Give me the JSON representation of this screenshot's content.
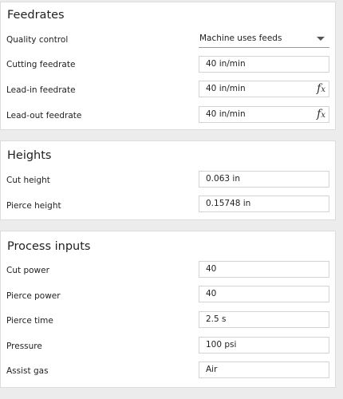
{
  "feedrates": {
    "title": "Feedrates",
    "quality_control": {
      "label": "Quality control",
      "value": "Machine uses feeds"
    },
    "cutting_feedrate": {
      "label": "Cutting feedrate",
      "value": "40 in/min"
    },
    "lead_in_feedrate": {
      "label": "Lead-in feedrate",
      "value": "40 in/min",
      "fx": "f",
      "fx_sub": "x"
    },
    "lead_out_feedrate": {
      "label": "Lead-out feedrate",
      "value": "40 in/min",
      "fx": "f",
      "fx_sub": "x"
    }
  },
  "heights": {
    "title": "Heights",
    "cut_height": {
      "label": "Cut height",
      "value": "0.063 in"
    },
    "pierce_height": {
      "label": "Pierce height",
      "value": "0.15748 in"
    }
  },
  "process_inputs": {
    "title": "Process inputs",
    "cut_power": {
      "label": "Cut power",
      "value": "40"
    },
    "pierce_power": {
      "label": "Pierce power",
      "value": "40"
    },
    "pierce_time": {
      "label": "Pierce time",
      "value": "2.5 s"
    },
    "pressure": {
      "label": "Pressure",
      "value": "100 psi"
    },
    "assist_gas": {
      "label": "Assist gas",
      "value": "Air"
    }
  }
}
